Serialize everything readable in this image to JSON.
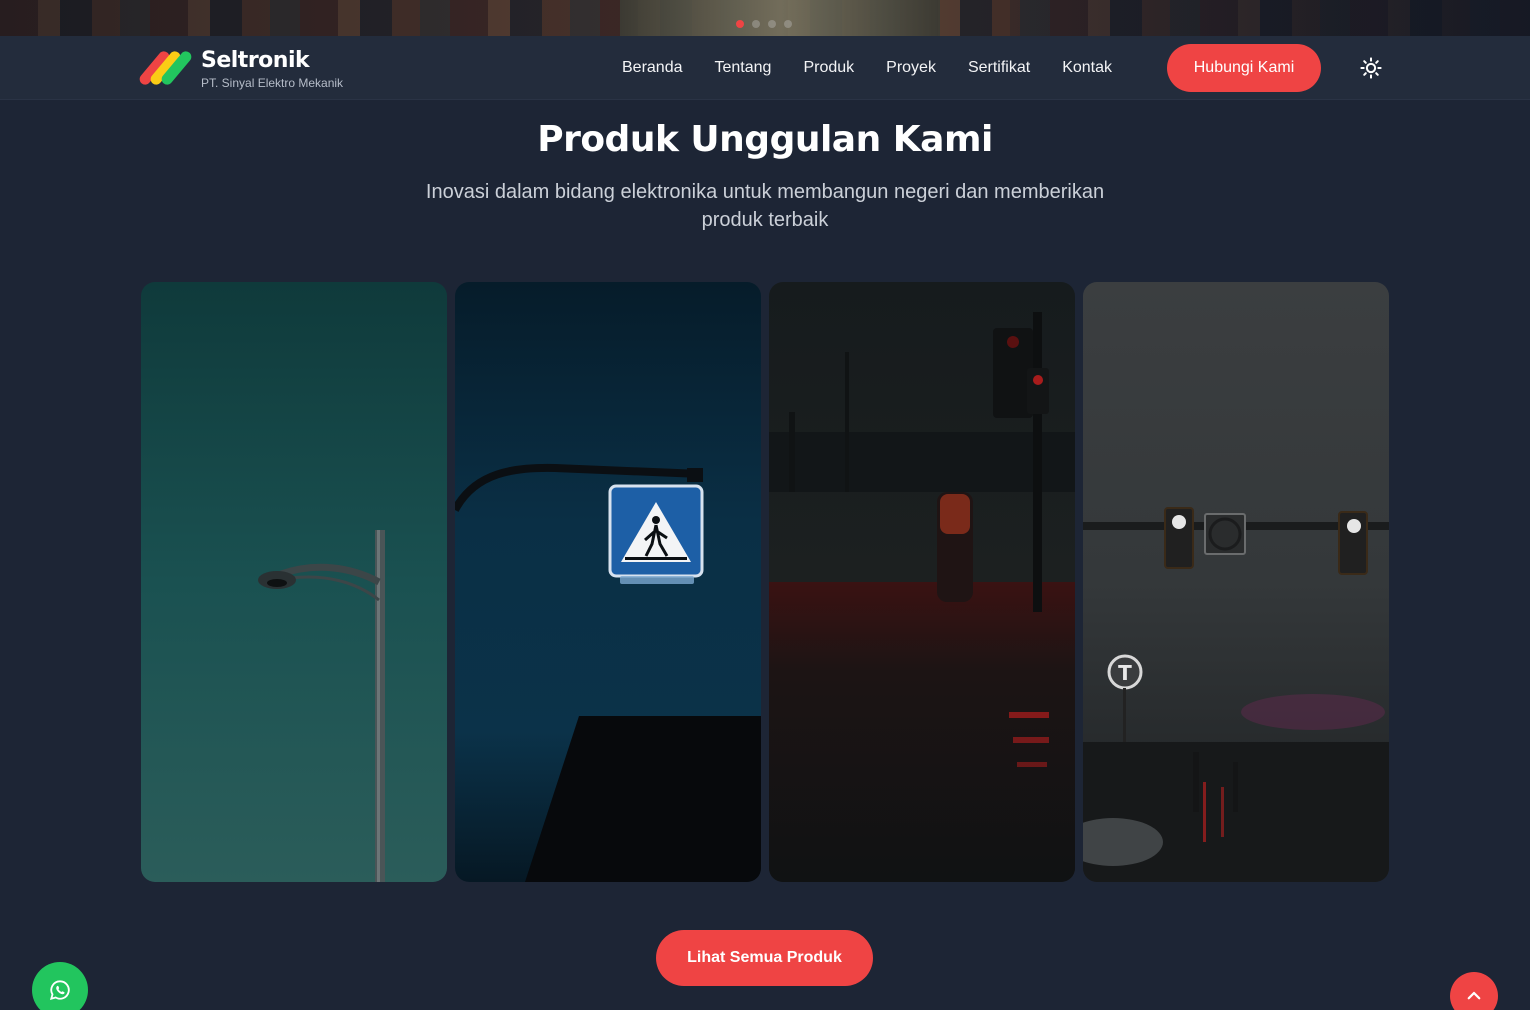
{
  "brand": {
    "name": "Seltronik",
    "subtitle": "PT. Sinyal Elektro Mekanik",
    "logo_colors": [
      "#ef4444",
      "#facc15",
      "#22c55e"
    ]
  },
  "hero": {
    "slide_count": 4,
    "active_slide": 1
  },
  "nav": {
    "links": [
      "Beranda",
      "Tentang",
      "Produk",
      "Proyek",
      "Sertifikat",
      "Kontak"
    ],
    "cta_label": "Hubungi Kami",
    "theme_icon": "sun-icon"
  },
  "section": {
    "title": "Produk Unggulan Kami",
    "subtitle": "Inovasi dalam bidang elektronika untuk membangun negeri dan memberikan produk terbaik"
  },
  "products": [
    {
      "image": "street-lamp-photo"
    },
    {
      "image": "pedestrian-crossing-sign-photo"
    },
    {
      "image": "night-traffic-light-photo"
    },
    {
      "image": "rainy-traffic-light-photo"
    }
  ],
  "buttons": {
    "view_all_label": "Lihat Semua Produk",
    "whatsapp_icon": "whatsapp-icon",
    "back_to_top_icon": "chevron-up-icon"
  },
  "colors": {
    "accent": "#ef4444",
    "background": "#1d2535",
    "navbar": "#232c3c",
    "whatsapp": "#22c55e"
  }
}
